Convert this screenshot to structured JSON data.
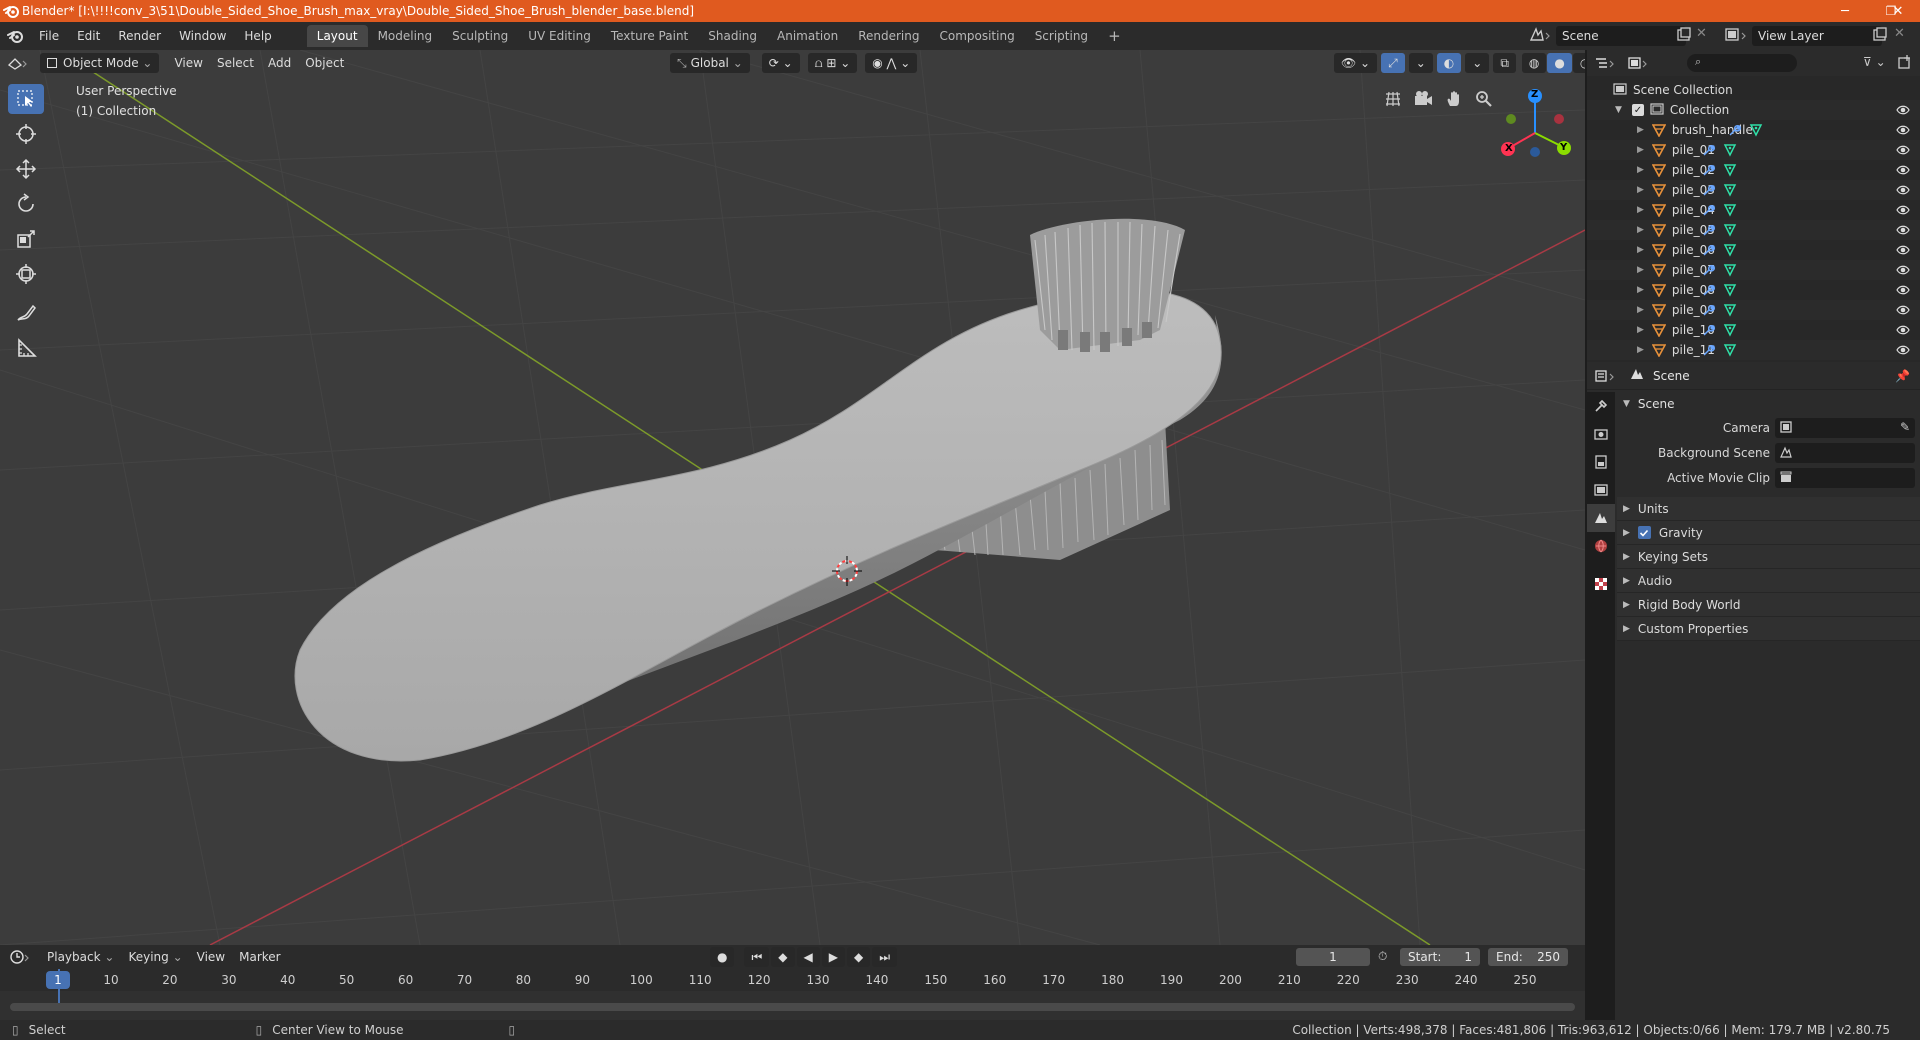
{
  "window": {
    "title": "Blender* [I:\\!!!!conv_3\\51\\Double_Sided_Shoe_Brush_max_vray\\Double_Sided_Shoe_Brush_blender_base.blend]",
    "minimize": "─",
    "maximize": "❐",
    "close": "✕"
  },
  "menus": [
    "File",
    "Edit",
    "Render",
    "Window",
    "Help"
  ],
  "workspaces": [
    "Layout",
    "Modeling",
    "Sculpting",
    "UV Editing",
    "Texture Paint",
    "Shading",
    "Animation",
    "Rendering",
    "Compositing",
    "Scripting"
  ],
  "add_workspace": "+",
  "scene_name": "Scene",
  "view_layer": "View Layer",
  "viewport": {
    "mode": "Object Mode",
    "menus": [
      "View",
      "Select",
      "Add",
      "Object"
    ],
    "transform_orientation": "Global",
    "perspective_label": "User Perspective",
    "collection_label": "(1) Collection",
    "gizmo": {
      "x": "X",
      "y": "Y",
      "z": "Z"
    }
  },
  "outliner": {
    "root": "Scene Collection",
    "collection": "Collection",
    "objects": [
      "brush_handle",
      "pile_01",
      "pile_02",
      "pile_03",
      "pile_04",
      "pile_05",
      "pile_06",
      "pile_07",
      "pile_08",
      "pile_09",
      "pile_10",
      "pile_11"
    ]
  },
  "properties": {
    "context": "Scene",
    "panel_title": "Scene",
    "fields": [
      {
        "label": "Camera"
      },
      {
        "label": "Background Scene"
      },
      {
        "label": "Active Movie Clip"
      }
    ],
    "subpanels": {
      "units": "Units",
      "gravity": "Gravity",
      "keying_sets": "Keying Sets",
      "audio": "Audio",
      "rigid_body_world": "Rigid Body World",
      "custom_properties": "Custom Properties"
    },
    "gravity_enabled": true
  },
  "timeline": {
    "menus": [
      "Playback",
      "Keying",
      "View",
      "Marker"
    ],
    "current_frame": "1",
    "start_label": "Start:",
    "start": "1",
    "end_label": "End:",
    "end": "250",
    "ticks": [
      "1",
      "10",
      "20",
      "30",
      "40",
      "50",
      "60",
      "70",
      "80",
      "90",
      "100",
      "110",
      "120",
      "130",
      "140",
      "150",
      "160",
      "170",
      "180",
      "190",
      "200",
      "210",
      "220",
      "230",
      "240",
      "250"
    ]
  },
  "status": {
    "select": "Select",
    "center_view": "Center View to Mouse",
    "stats": "Collection | Verts:498,378 | Faces:481,806 | Tris:963,612 | Objects:0/66 | Mem: 179.7 MB | v2.80.75"
  },
  "colors": {
    "accent": "#4772b3",
    "title_bar": "#e05a1f",
    "x_axis": "#ff3352",
    "y_axis": "#8bdc00",
    "z_axis": "#2890ff",
    "mesh": "#cfcfcf"
  }
}
